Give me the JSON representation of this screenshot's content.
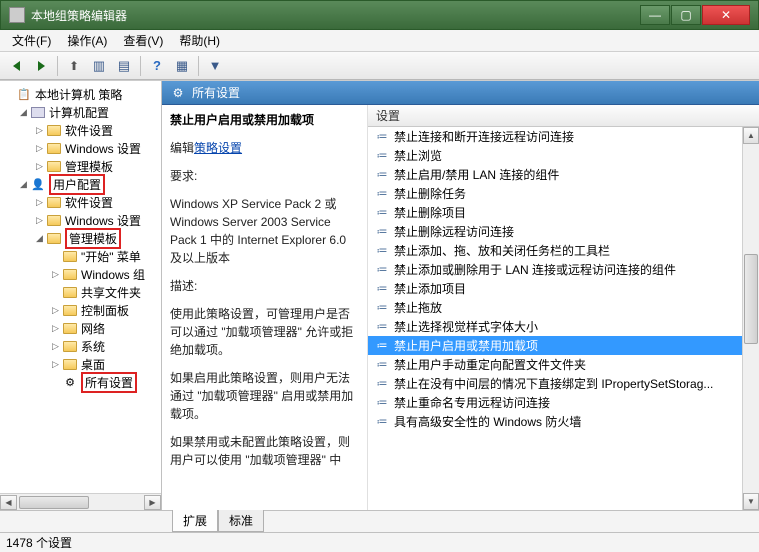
{
  "window": {
    "title": "本地组策略编辑器"
  },
  "menu": {
    "file": "文件(F)",
    "action": "操作(A)",
    "view": "查看(V)",
    "help": "帮助(H)"
  },
  "tree": {
    "root": "本地计算机 策略",
    "computer_config": "计算机配置",
    "software_settings": "软件设置",
    "windows_settings": "Windows 设置",
    "admin_templates": "管理模板",
    "user_config": "用户配置",
    "start_menu": "\"开始\" 菜单",
    "windows_components": "Windows 组",
    "shared_folders": "共享文件夹",
    "control_panel": "控制面板",
    "network": "网络",
    "system": "系统",
    "desktop": "桌面",
    "all_settings": "所有设置"
  },
  "detail": {
    "header": "所有设置",
    "title": "禁止用户启用或禁用加载项",
    "edit_prefix": "编辑",
    "edit_link": "策略设置",
    "req_label": "要求:",
    "req_text": "Windows XP Service Pack 2 或 Windows Server 2003 Service Pack 1 中的 Internet Explorer 6.0 及以上版本",
    "desc_label": "描述:",
    "desc_p1": "使用此策略设置，可管理用户是否可以通过 \"加载项管理器\" 允许或拒绝加载项。",
    "desc_p2": "如果启用此策略设置，则用户无法通过 \"加载项管理器\" 启用或禁用加载项。",
    "desc_p3": "如果禁用或未配置此策略设置，则用户可以使用 \"加载项管理器\" 中"
  },
  "list": {
    "column": "设置",
    "items": [
      "禁止连接和断开连接远程访问连接",
      "禁止浏览",
      "禁止启用/禁用 LAN 连接的组件",
      "禁止删除任务",
      "禁止删除项目",
      "禁止删除远程访问连接",
      "禁止添加、拖、放和关闭任务栏的工具栏",
      "禁止添加或删除用于 LAN 连接或远程访问连接的组件",
      "禁止添加项目",
      "禁止拖放",
      "禁止选择视觉样式字体大小",
      "禁止用户启用或禁用加载项",
      "禁止用户手动重定向配置文件文件夹",
      "禁止在没有中间层的情况下直接绑定到 IPropertySetStorag...",
      "禁止重命名专用远程访问连接",
      "具有高级安全性的 Windows 防火墙"
    ],
    "selected_index": 11
  },
  "tabs": {
    "extended": "扩展",
    "standard": "标准"
  },
  "status": {
    "text": "1478 个设置"
  }
}
